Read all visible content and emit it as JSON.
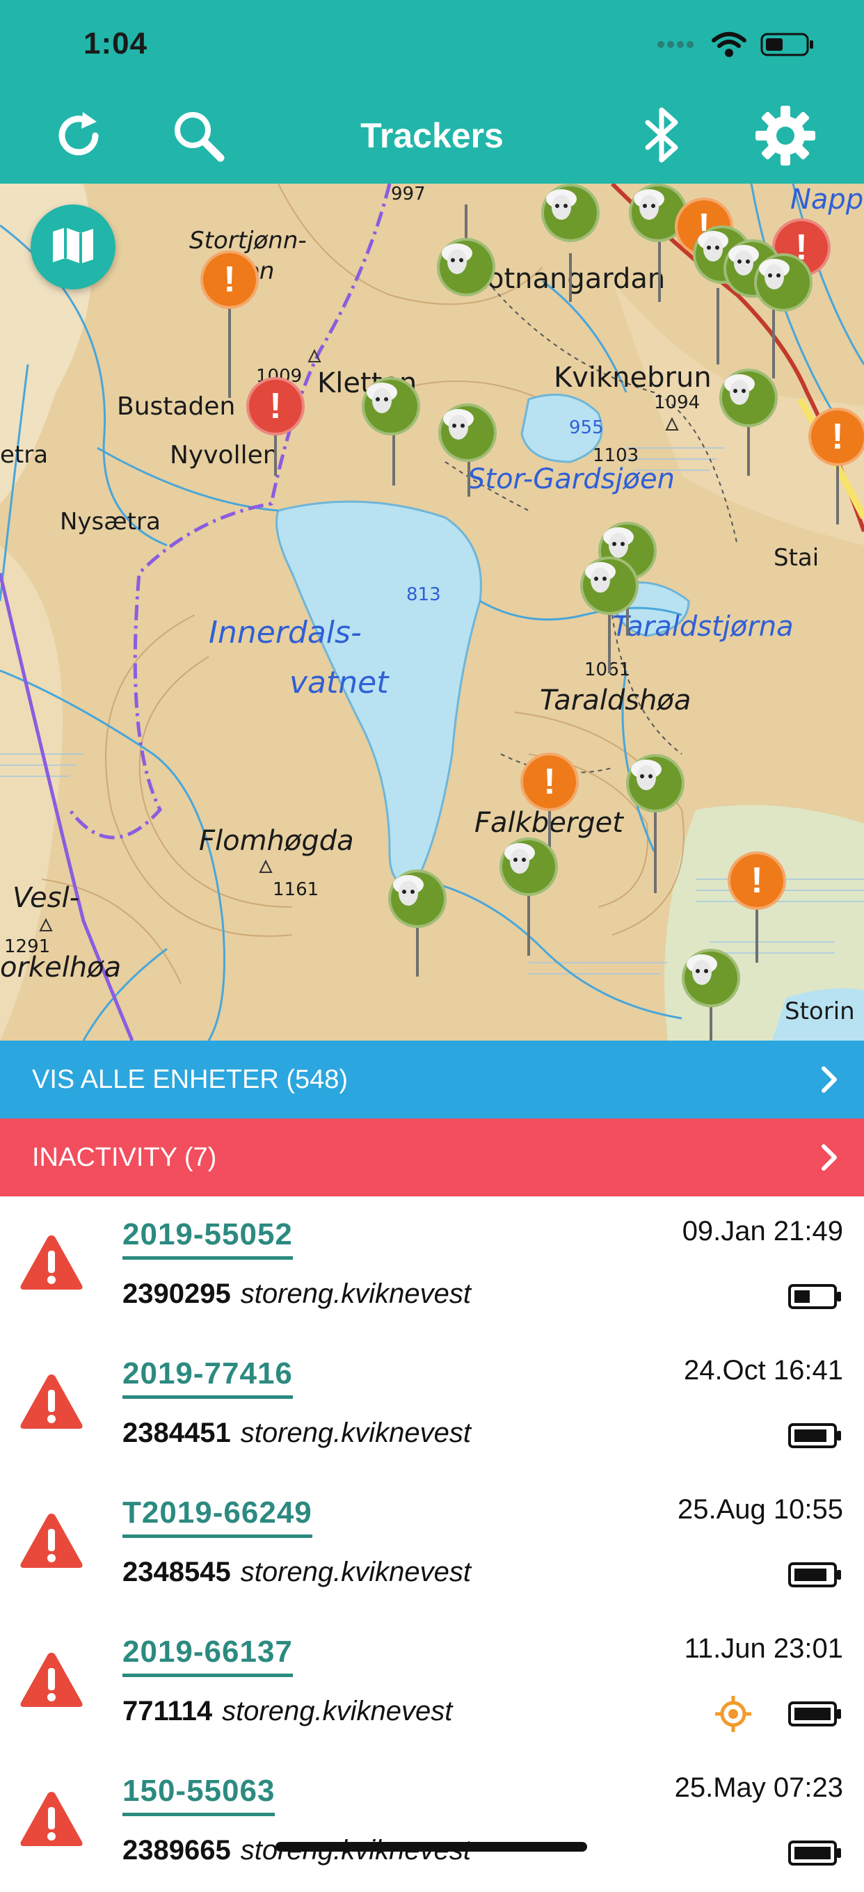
{
  "status_bar": {
    "time": "1:04"
  },
  "header": {
    "title": "Trackers",
    "icons": [
      "refresh-icon",
      "search-icon",
      "bluetooth-icon",
      "gear-icon"
    ],
    "accent": "#21b6a9"
  },
  "map": {
    "labels": [
      "Stortjønn-",
      "en",
      "Bustaden",
      "Nyvollen",
      "Nysætra",
      "etra",
      "Kletten",
      "Kviknebrun",
      "Stor-Gardsjøen",
      "otnangardan",
      "Napp",
      "Innerdals-",
      "vatnet",
      "Taraldstjørna",
      "Taraldshøa",
      "Falkberget",
      "Flomhøgda",
      "Vesl-",
      "orkelhøa",
      "Stai",
      "Storin",
      "997",
      "1009",
      "955",
      "1094",
      "1103",
      "813",
      "1061",
      "1161",
      "1291"
    ],
    "marker_legend": {
      "sheep": "#6e9a2c",
      "warning": "#ef7a1a",
      "alarm": "#e2483b"
    }
  },
  "bars": {
    "all_units": "VIS ALLE ENHETER (548)",
    "inactivity": "INACTIVITY (7)"
  },
  "trackers": [
    {
      "tag": "2019-55052",
      "id": "2390295",
      "owner": "storeng.kviknevest",
      "time": "09.Jan 21:49",
      "battery": "low",
      "gps": false
    },
    {
      "tag": "2019-77416",
      "id": "2384451",
      "owner": "storeng.kviknevest",
      "time": "24.Oct 16:41",
      "battery": "high",
      "gps": false
    },
    {
      "tag": "T2019-66249",
      "id": "2348545",
      "owner": "storeng.kviknevest",
      "time": "25.Aug 10:55",
      "battery": "high",
      "gps": false
    },
    {
      "tag": "2019-66137",
      "id": "771114",
      "owner": "storeng.kviknevest",
      "time": "11.Jun 23:01",
      "battery": "full",
      "gps": true
    },
    {
      "tag": "150-55063",
      "id": "2389665",
      "owner": "storeng.kviknevest",
      "time": "25.May 07:23",
      "battery": "full",
      "gps": false
    }
  ]
}
